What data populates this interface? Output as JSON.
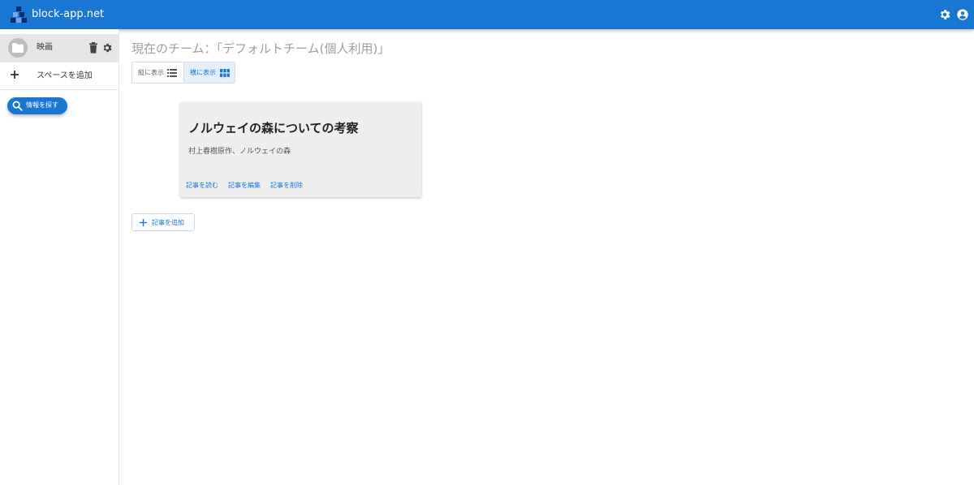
{
  "header": {
    "brand": "block-app.net",
    "settings_icon": "gear-icon",
    "account_icon": "account-circle-icon",
    "logo_icon": "blocks-logo-icon",
    "color": "#1976d2"
  },
  "sidebar": {
    "space": {
      "label": "映画",
      "avatar_icon": "folder-icon",
      "delete_icon": "trash-icon",
      "settings_icon": "gear-icon"
    },
    "add_space": {
      "label": "スペースを追加",
      "icon": "plus-icon"
    },
    "search_button": {
      "label": "情報を探す",
      "icon": "search-icon"
    }
  },
  "main": {
    "title": "現在のチーム：「デフォルトチーム(個人利用)」",
    "view_toggle": {
      "vertical_label": "縦に表示",
      "vertical_icon": "list-icon",
      "horizontal_label": "横に表示",
      "horizontal_icon": "grid-icon",
      "selected": "horizontal"
    },
    "articles": [
      {
        "title": "ノルウェイの森についての考察",
        "description": "村上春樹原作、ノルウェイの森",
        "actions": [
          "記事を読む",
          "記事を編集",
          "記事を削除"
        ]
      }
    ],
    "add_article": {
      "label": "記事を追加",
      "icon": "plus-icon"
    }
  }
}
